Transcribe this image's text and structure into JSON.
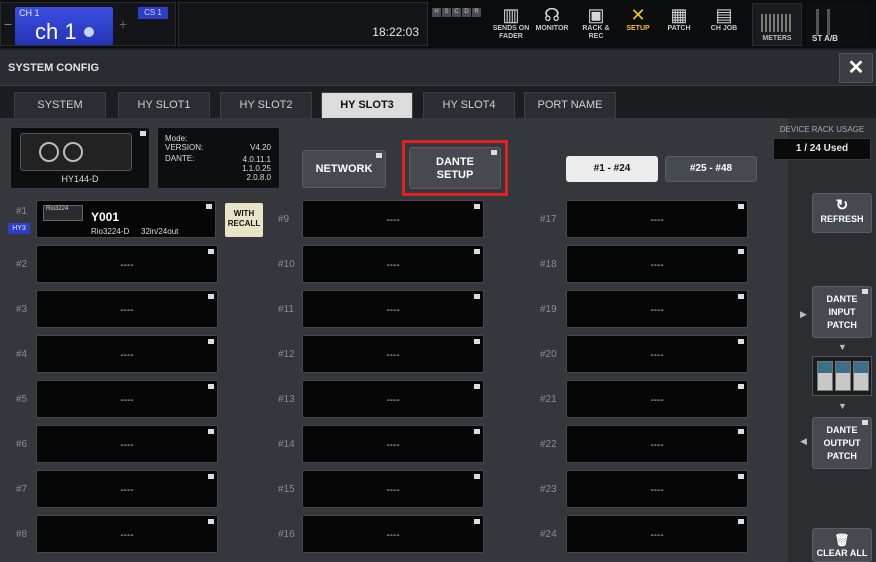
{
  "topbar": {
    "ch_small": "CH 1",
    "ch_name": "ch 1",
    "ch_minus": "−",
    "ch_plus": "+",
    "cs_badge": "CS 1",
    "clock": "18:22:03",
    "mini_keys": [
      "H",
      "S",
      "C",
      "D",
      "R"
    ],
    "buttons": [
      {
        "label": "SENDS ON FADER",
        "icon": "sends-on-fader-icon",
        "glyph": "▥"
      },
      {
        "label": "MONITOR",
        "icon": "headphones-icon",
        "glyph": "☊"
      },
      {
        "label": "RACK & REC",
        "icon": "rack-icon",
        "glyph": "▣"
      },
      {
        "label": "SETUP",
        "icon": "tools-icon",
        "glyph": "✕"
      },
      {
        "label": "PATCH",
        "icon": "patch-icon",
        "glyph": "▦"
      },
      {
        "label": "CH JOB",
        "icon": "ch-job-icon",
        "glyph": "▤"
      }
    ],
    "meters_label": "METERS",
    "stab_label": "ST A/B"
  },
  "header": {
    "title": "SYSTEM CONFIG",
    "close_glyph": "✕"
  },
  "tabs": [
    "SYSTEM",
    "HY SLOT1",
    "HY SLOT2",
    "HY SLOT3",
    "HY SLOT4",
    "PORT NAME"
  ],
  "active_tab": "HY SLOT3",
  "card": {
    "name": "HY144-D",
    "mode_label": "Mode:",
    "version_label": "VERSION:",
    "version_value": "V4.20",
    "dante_label": "DANTE:",
    "dante_values": [
      "4.0.11.1",
      "1.1.0.25",
      "2.0.8.0"
    ]
  },
  "buttons": {
    "network": "NETWORK",
    "dante_setup": [
      "DANTE",
      "SETUP"
    ],
    "page_1": "#1 - #24",
    "page_2": "#25 - #48"
  },
  "slots": [
    {
      "num": "#1",
      "value": "Y001"
    },
    {
      "num": "#2",
      "value": "----"
    },
    {
      "num": "#3",
      "value": "----"
    },
    {
      "num": "#4",
      "value": "----"
    },
    {
      "num": "#5",
      "value": "----"
    },
    {
      "num": "#6",
      "value": "----"
    },
    {
      "num": "#7",
      "value": "----"
    },
    {
      "num": "#8",
      "value": "----"
    },
    {
      "num": "#9",
      "value": "----"
    },
    {
      "num": "#10",
      "value": "----"
    },
    {
      "num": "#11",
      "value": "----"
    },
    {
      "num": "#12",
      "value": "----"
    },
    {
      "num": "#13",
      "value": "----"
    },
    {
      "num": "#14",
      "value": "----"
    },
    {
      "num": "#15",
      "value": "----"
    },
    {
      "num": "#16",
      "value": "----"
    },
    {
      "num": "#17",
      "value": "----"
    },
    {
      "num": "#18",
      "value": "----"
    },
    {
      "num": "#19",
      "value": "----"
    },
    {
      "num": "#20",
      "value": "----"
    },
    {
      "num": "#21",
      "value": "----"
    },
    {
      "num": "#22",
      "value": "----"
    },
    {
      "num": "#23",
      "value": "----"
    },
    {
      "num": "#24",
      "value": "----"
    }
  ],
  "slot1": {
    "tag": "HY3",
    "pic_text": "Rio3224",
    "name": "Y001",
    "model": "Rio3224-D",
    "io": "32in/24out",
    "recall": [
      "WITH",
      "RECALL"
    ]
  },
  "right": {
    "rack_label": "DEVICE RACK USAGE",
    "rack_value": "1 / 24 Used",
    "refresh": "REFRESH",
    "refresh_glyph": "↻",
    "dante_input": [
      "DANTE",
      "INPUT",
      "PATCH"
    ],
    "dante_output": [
      "DANTE",
      "OUTPUT",
      "PATCH"
    ],
    "clear_all": "CLEAR ALL",
    "clear_glyph": "🗑",
    "arrow_right": "▶",
    "arrow_left": "◀",
    "arrow_down": "▼"
  },
  "colors": {
    "highlight": "#e02020",
    "setup_active": "#f5c21a",
    "channel_blue": "#2434b8"
  }
}
